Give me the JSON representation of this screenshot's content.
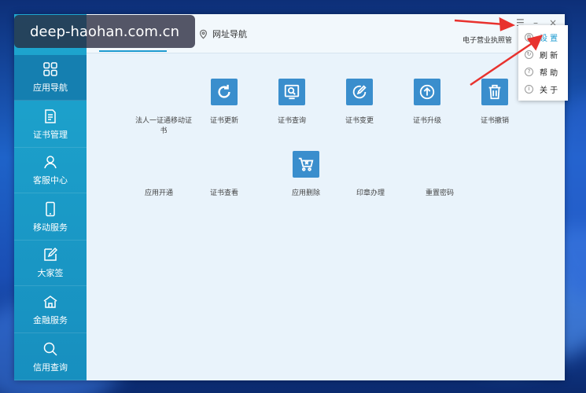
{
  "watermark": "deep-haohan.com.cn",
  "sidebar": {
    "items": [
      {
        "label": "应用导航",
        "icon": "grid-icon"
      },
      {
        "label": "证书管理",
        "icon": "document-icon"
      },
      {
        "label": "客服中心",
        "icon": "user-icon"
      },
      {
        "label": "移动服务",
        "icon": "phone-icon"
      },
      {
        "label": "大家签",
        "icon": "edit-icon"
      },
      {
        "label": "金融服务",
        "icon": "bank-icon"
      },
      {
        "label": "信用查询",
        "icon": "search-icon"
      }
    ]
  },
  "topbar": {
    "url_nav_label": "网址导航",
    "license_link": "电子营业执照管"
  },
  "apps": {
    "row1": [
      {
        "label": "法人一证通移动证书",
        "icon": "none"
      },
      {
        "label": "证书更新",
        "icon": "refresh-icon"
      },
      {
        "label": "证书查询",
        "icon": "search-doc-icon"
      },
      {
        "label": "证书变更",
        "icon": "edit-circle-icon"
      },
      {
        "label": "证书升级",
        "icon": "upgrade-icon"
      },
      {
        "label": "证书撤销",
        "icon": "trash-icon"
      }
    ],
    "row2": [
      {
        "label": "应用开通",
        "icon": "none"
      },
      {
        "label": "证书查看",
        "icon": "none"
      },
      {
        "label": "应用删除",
        "icon": "cart-delete-icon"
      },
      {
        "label": "印章办理",
        "icon": "none"
      },
      {
        "label": "重置密码",
        "icon": "none"
      }
    ]
  },
  "dropdown": {
    "items": [
      {
        "label": "设 置",
        "icon": "settings-icon"
      },
      {
        "label": "刷 新",
        "icon": "refresh-icon"
      },
      {
        "label": "帮 助",
        "icon": "help-icon"
      },
      {
        "label": "关 于",
        "icon": "info-icon"
      }
    ]
  },
  "colors": {
    "sidebar": "#1ea6cf",
    "accent": "#1e9bd0",
    "tile": "#3a8ecd",
    "arrow": "#e8322e"
  }
}
